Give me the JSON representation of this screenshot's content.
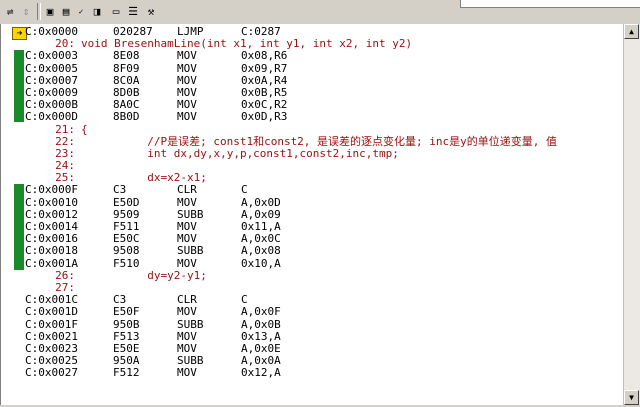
{
  "toolbar": {
    "icons": [
      "brackets-icon",
      "select-icon",
      "disassembly-icon",
      "memory-icon",
      "code-coverage-icon",
      "check-icon",
      "watch-icon",
      "window-icon",
      "list-icon",
      "hammer-icon"
    ]
  },
  "disassembly": {
    "lines": [
      {
        "type": "asm",
        "addr": "C:0x0000",
        "op": "020287",
        "mn": "LJMP",
        "arg": "C:0287"
      },
      {
        "type": "src",
        "num": "20:",
        "text": "void BresenhamLine(int x1, int y1, int x2, int y2)"
      },
      {
        "type": "asm",
        "addr": "C:0x0003",
        "op": "8E08",
        "mn": "MOV",
        "arg": "0x08,R6"
      },
      {
        "type": "asm",
        "addr": "C:0x0005",
        "op": "8F09",
        "mn": "MOV",
        "arg": "0x09,R7"
      },
      {
        "type": "asm",
        "addr": "C:0x0007",
        "op": "8C0A",
        "mn": "MOV",
        "arg": "0x0A,R4"
      },
      {
        "type": "asm",
        "addr": "C:0x0009",
        "op": "8D0B",
        "mn": "MOV",
        "arg": "0x0B,R5"
      },
      {
        "type": "asm",
        "addr": "C:0x000B",
        "op": "8A0C",
        "mn": "MOV",
        "arg": "0x0C,R2"
      },
      {
        "type": "asm",
        "addr": "C:0x000D",
        "op": "8B0D",
        "mn": "MOV",
        "arg": "0x0D,R3"
      },
      {
        "type": "src",
        "num": "21:",
        "text": "{"
      },
      {
        "type": "src",
        "num": "22:",
        "text": "          //P是误差; const1和const2, 是误差的逐点变化量; inc是y的单位递变量, 值"
      },
      {
        "type": "src",
        "num": "23:",
        "text": "          int dx,dy,x,y,p,const1,const2,inc,tmp;"
      },
      {
        "type": "src",
        "num": "24:",
        "text": ""
      },
      {
        "type": "src",
        "num": "25:",
        "text": "          dx=x2-x1;"
      },
      {
        "type": "asm",
        "addr": "C:0x000F",
        "op": "C3",
        "mn": "CLR",
        "arg": "C"
      },
      {
        "type": "asm",
        "addr": "C:0x0010",
        "op": "E50D",
        "mn": "MOV",
        "arg": "A,0x0D"
      },
      {
        "type": "asm",
        "addr": "C:0x0012",
        "op": "9509",
        "mn": "SUBB",
        "arg": "A,0x09"
      },
      {
        "type": "asm",
        "addr": "C:0x0014",
        "op": "F511",
        "mn": "MOV",
        "arg": "0x11,A"
      },
      {
        "type": "asm",
        "addr": "C:0x0016",
        "op": "E50C",
        "mn": "MOV",
        "arg": "A,0x0C"
      },
      {
        "type": "asm",
        "addr": "C:0x0018",
        "op": "9508",
        "mn": "SUBB",
        "arg": "A,0x08"
      },
      {
        "type": "asm",
        "addr": "C:0x001A",
        "op": "F510",
        "mn": "MOV",
        "arg": "0x10,A"
      },
      {
        "type": "src",
        "num": "26:",
        "text": "          dy=y2-y1;"
      },
      {
        "type": "src",
        "num": "27:",
        "text": ""
      },
      {
        "type": "asm",
        "addr": "C:0x001C",
        "op": "C3",
        "mn": "CLR",
        "arg": "C"
      },
      {
        "type": "asm",
        "addr": "C:0x001D",
        "op": "E50F",
        "mn": "MOV",
        "arg": "A,0x0F"
      },
      {
        "type": "asm",
        "addr": "C:0x001F",
        "op": "950B",
        "mn": "SUBB",
        "arg": "A,0x0B"
      },
      {
        "type": "asm",
        "addr": "C:0x0021",
        "op": "F513",
        "mn": "MOV",
        "arg": "0x13,A"
      },
      {
        "type": "asm",
        "addr": "C:0x0023",
        "op": "E50E",
        "mn": "MOV",
        "arg": "A,0x0E"
      },
      {
        "type": "asm",
        "addr": "C:0x0025",
        "op": "950A",
        "mn": "SUBB",
        "arg": "A,0x0A"
      },
      {
        "type": "asm",
        "addr": "C:0x0027",
        "op": "F512",
        "mn": "MOV",
        "arg": "0x12,A"
      }
    ]
  },
  "colors": {
    "coverage": "#1a8a2a",
    "source_text": "#9a1010",
    "pointer": "#ffd400"
  }
}
